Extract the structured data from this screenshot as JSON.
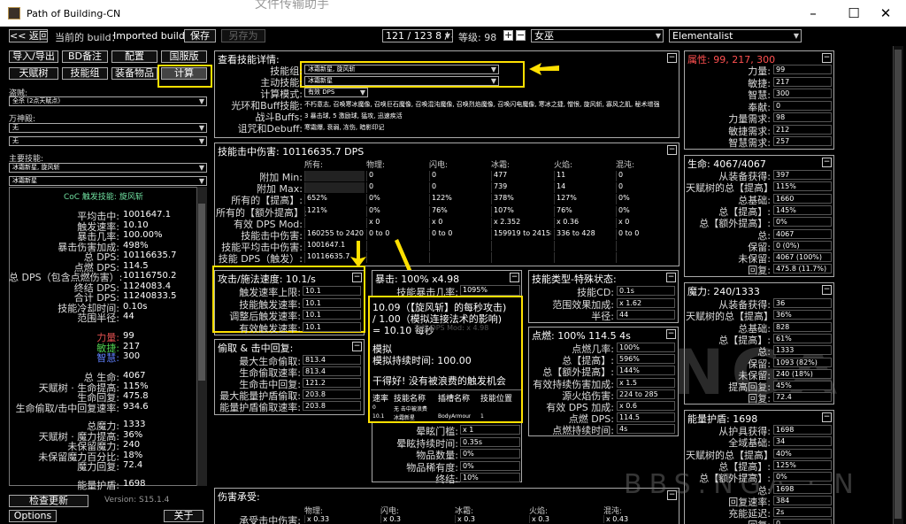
{
  "window": {
    "title": "Path of Building-CN",
    "bg_title": "文件传输助手"
  },
  "toolbar": {
    "back": "<< 返回",
    "build_label": "当前的 build：",
    "build_name": "Imported build",
    "save": "保存",
    "saveas": "另存为",
    "counter": "121 / 123   8 / 8",
    "level_label": "等级: 98",
    "class": "女巫",
    "ascendancy": "Elementalist"
  },
  "tabs": {
    "import": "导入/导出",
    "notes": "BD备注",
    "config": "配置",
    "version": "国服版",
    "tree": "天赋树",
    "skills": "技能组",
    "items": "装备物品",
    "calcs": "计算"
  },
  "left": {
    "bandit_label": "盗贼:",
    "bandit": "全杀 (2点天赋点)",
    "pantheon_label": "万神殿:",
    "pantheon1": "无",
    "pantheon2": "无",
    "main_skill_label": "主要技能:",
    "main_skill": "冰霜新星, 旋风斩",
    "main_skill2": "冰霜新星",
    "coc_title": "CoC 触发技能: 旋风斩",
    "stats": [
      {
        "k": "平均击中:",
        "v": "1001647.1"
      },
      {
        "k": "触发速率:",
        "v": "10.10"
      },
      {
        "k": "暴击几率:",
        "v": "100.00%"
      },
      {
        "k": "暴击伤害加成:",
        "v": "498%"
      },
      {
        "k": "总 DPS:",
        "v": "10116635.7"
      },
      {
        "k": "点燃 DPS:",
        "v": "114.5"
      },
      {
        "k": "总 DPS（包含点燃伤害）:",
        "v": "10116750.2"
      },
      {
        "k": "终结 DPS:",
        "v": "1124083.4"
      },
      {
        "k": "合计 DPS:",
        "v": "11240833.5"
      },
      {
        "k": "技能冷却时间:",
        "v": "0.10s"
      },
      {
        "k": "范围半径:",
        "v": "44"
      }
    ],
    "attrs": [
      {
        "k": "力量:",
        "v": "99",
        "c": "#e05050"
      },
      {
        "k": "敏捷:",
        "v": "217",
        "c": "#50d050"
      },
      {
        "k": "智慧:",
        "v": "300",
        "c": "#6080ff"
      }
    ],
    "life": [
      {
        "k": "总 生命:",
        "v": "4067"
      },
      {
        "k": "天赋树 · 生命提高:",
        "v": "115%"
      },
      {
        "k": "生命回复:",
        "v": "475.8"
      },
      {
        "k": "生命偷取/击中回复速率:",
        "v": "934.6"
      }
    ],
    "mana": [
      {
        "k": "总魔力:",
        "v": "1333"
      },
      {
        "k": "天赋树 · 魔力提高:",
        "v": "36%"
      },
      {
        "k": "未保留魔力:",
        "v": "240"
      },
      {
        "k": "未保留魔力百分比:",
        "v": "18%"
      },
      {
        "k": "魔力回复:",
        "v": "72.4"
      },
      {
        "k": "能量护盾:",
        "v": "1698"
      }
    ],
    "update": "检查更新",
    "version": "Version: S15.1.4",
    "options": "Options",
    "about": "关于"
  },
  "skill_detail": {
    "title": "查看技能详情:",
    "rows": [
      {
        "k": "技能组:",
        "v": "冰霜新星, 旋风斩"
      },
      {
        "k": "主动技能:",
        "v": "冰霜新星"
      },
      {
        "k": "计算模式:",
        "v": "有效 DPS"
      },
      {
        "k": "光环和Buff技能:",
        "v": "不朽意志, 召唤寒冰魔像, 召唤巨石魔像, 召唤混沌魔像, 召唤烈焰魔像, 召唤闪电魔像, 寒冰之捷, 憎恨, 旋风斩, 寡风之肌, 秘术增强"
      },
      {
        "k": "战斗Buffs:",
        "v": "3 暴击球, 5 激励球, 猛攻, 迅速疾活"
      },
      {
        "k": "诅咒和Debuff:",
        "v": "寒霜爆, 衰弱, 冻伤, 暗影印记"
      }
    ]
  },
  "hit_damage": {
    "title": "技能击中伤害: 10116635.7 DPS",
    "cols": [
      "所有:",
      "物理:",
      "闪电:",
      "冰霜:",
      "火焰:",
      "混沌:"
    ],
    "rows": [
      {
        "k": "附加 Min:",
        "c": [
          "",
          "0",
          "0",
          "477",
          "11",
          "0"
        ]
      },
      {
        "k": "附加 Max:",
        "c": [
          "",
          "0",
          "0",
          "739",
          "14",
          "0"
        ]
      },
      {
        "k": "所有的【提高】:",
        "c": [
          "652%",
          "0%",
          "122%",
          "378%",
          "127%",
          "0%"
        ]
      },
      {
        "k": "所有的【额外提高】:",
        "c": [
          "121%",
          "0%",
          "76%",
          "107%",
          "76%",
          "0%"
        ]
      },
      {
        "k": "有效 DPS Mod:",
        "c": [
          "",
          "x 0",
          "x 0",
          "x 2.352",
          "x 0.36",
          "x 0"
        ]
      },
      {
        "k": "技能击中伤害:",
        "c": [
          "160255 to 242013",
          "0 to 0",
          "0 to 0",
          "159919 to 241585",
          "336 to 428",
          "0 to 0"
        ]
      },
      {
        "k": "技能平均击中伤害:",
        "c": [
          "1001647.1",
          "",
          "",
          "",
          "",
          ""
        ]
      },
      {
        "k": "技能 DPS（触发）:",
        "c": [
          "10116635.7",
          "",
          "",
          "",
          "",
          ""
        ]
      }
    ]
  },
  "attack_speed": {
    "title": "攻击/施法速度: 10.1/s",
    "rows": [
      {
        "k": "触发速率上限:",
        "v": "10.1"
      },
      {
        "k": "技能触发速率:",
        "v": "10.1"
      },
      {
        "k": "调整后触发速率:",
        "v": "10.1"
      },
      {
        "k": "有效触发速率:",
        "v": "10.1"
      }
    ]
  },
  "crit": {
    "title": "暴击: 100% x4.98",
    "row": {
      "k": "技能暴击几率:",
      "v": "1095%"
    }
  },
  "tooltip": {
    "line1": "10.09（【旋风斩】的每秒攻击)",
    "line2": "/ 1.00（模拟连接法术的影响)",
    "line3": "= 10.10 每秒",
    "line4": "模拟",
    "line5": "模拟持续时间: 100.00",
    "line6": "干得好! 没有被浪费的触发机会",
    "th": [
      "速率",
      "技能名称",
      "插槽名称",
      "技能位置"
    ],
    "r1": [
      "0",
      "无 击中被浪费",
      "",
      ""
    ],
    "r2": [
      "10.1",
      "冰霜新星",
      "BodyArmour",
      "1"
    ],
    "hidden_mod": "有效 DPS Mod:  x 4.98"
  },
  "crit_extra": [
    {
      "k": "晕眩门槛:",
      "v": "x 1"
    },
    {
      "k": "晕眩持续时间:",
      "v": "0.35s"
    },
    {
      "k": "物品数量:",
      "v": "0%"
    },
    {
      "k": "物品稀有度:",
      "v": "0%"
    },
    {
      "k": "终结:",
      "v": "10%"
    }
  ],
  "leech": {
    "title": "偷取 & 击中回复:",
    "rows": [
      {
        "k": "最大生命偷取:",
        "v": "813.4"
      },
      {
        "k": "生命偷取速率:",
        "v": "813.4"
      },
      {
        "k": "生命击中回复:",
        "v": "121.2"
      },
      {
        "k": "最大能量护盾偷取:",
        "v": "203.8"
      },
      {
        "k": "能量护盾偷取速率:",
        "v": "203.8"
      }
    ]
  },
  "skill_type": {
    "title": "技能类型-特殊状态:",
    "rows": [
      {
        "k": "技能CD:",
        "v": "0.1s"
      },
      {
        "k": "范围效果加成:",
        "v": "x 1.62"
      },
      {
        "k": "半径:",
        "v": "44"
      }
    ]
  },
  "ignite": {
    "title": "点燃: 100% 114.5 4s",
    "rows": [
      {
        "k": "点燃几率:",
        "v": "100%"
      },
      {
        "k": "总【提高】:",
        "v": "596%"
      },
      {
        "k": "总【额外提高】:",
        "v": "144%"
      },
      {
        "k": "有效持续伤害加成:",
        "v": "x 1.5"
      },
      {
        "k": "源火焰伤害:",
        "v": "224 to 285"
      },
      {
        "k": "有效 DPS 加成:",
        "v": "x 0.6"
      },
      {
        "k": "点燃 DPS:",
        "v": "114.5"
      },
      {
        "k": "点燃持续时间:",
        "v": "4s"
      }
    ]
  },
  "taken": {
    "title": "伤害承受:",
    "cols": [
      "物理:",
      "闪电:",
      "冰霜:",
      "火焰:",
      "混沌:"
    ],
    "row_k": "承受击中伤害:",
    "row_v": [
      "x 0.33",
      "x 0.3",
      "x 0.3",
      "x 0.3",
      "x 0.43"
    ]
  },
  "attributes": {
    "title": "属性: 99, 217, 300",
    "rows": [
      {
        "k": "力量:",
        "v": "99"
      },
      {
        "k": "敏捷:",
        "v": "217"
      },
      {
        "k": "智慧:",
        "v": "300"
      },
      {
        "k": "奉献:",
        "v": "0"
      },
      {
        "k": "力量需求:",
        "v": "98"
      },
      {
        "k": "敏捷需求:",
        "v": "212"
      },
      {
        "k": "智慧需求:",
        "v": "257"
      }
    ]
  },
  "life_sec": {
    "title": "生命: 4067/4067",
    "rows": [
      {
        "k": "从装备获得:",
        "v": "397"
      },
      {
        "k": "天赋树的总【提高】:",
        "v": "115%"
      },
      {
        "k": "总基础:",
        "v": "1660"
      },
      {
        "k": "总【提高】:",
        "v": "145%"
      },
      {
        "k": "总【额外提高】:",
        "v": "0%"
      },
      {
        "k": "总:",
        "v": "4067"
      },
      {
        "k": "保留:",
        "v": "0 (0%)"
      },
      {
        "k": "未保留:",
        "v": "4067 (100%)"
      },
      {
        "k": "回复:",
        "v": "475.8 (11.7%)"
      }
    ]
  },
  "mana_sec": {
    "title": "魔力: 240/1333",
    "rows": [
      {
        "k": "从装备获得:",
        "v": "36"
      },
      {
        "k": "天赋树的总【提高】:",
        "v": "36%"
      },
      {
        "k": "总基础:",
        "v": "828"
      },
      {
        "k": "总【提高】:",
        "v": "61%"
      },
      {
        "k": "总:",
        "v": "1333"
      },
      {
        "k": "保留:",
        "v": "1093 (82%)"
      },
      {
        "k": "未保留:",
        "v": "240 (18%)"
      },
      {
        "k": "提高回复:",
        "v": "45%"
      },
      {
        "k": "回复:",
        "v": "72.4"
      }
    ]
  },
  "es_sec": {
    "title": "能量护盾: 1698",
    "rows": [
      {
        "k": "从护具获得:",
        "v": "1698"
      },
      {
        "k": "全域基础:",
        "v": "34"
      },
      {
        "k": "天赋树的总【提高】:",
        "v": "40%"
      },
      {
        "k": "总【提高】:",
        "v": "125%"
      },
      {
        "k": "总【额外提高】:",
        "v": "0%"
      },
      {
        "k": "总:",
        "v": "1698"
      },
      {
        "k": "回复速率:",
        "v": "384"
      },
      {
        "k": "充能延迟:",
        "v": "2s"
      },
      {
        "k": "回复:",
        "v": "0"
      }
    ]
  },
  "watermark": {
    "big": "NGA",
    "small": "BBS.NGA.CN"
  }
}
